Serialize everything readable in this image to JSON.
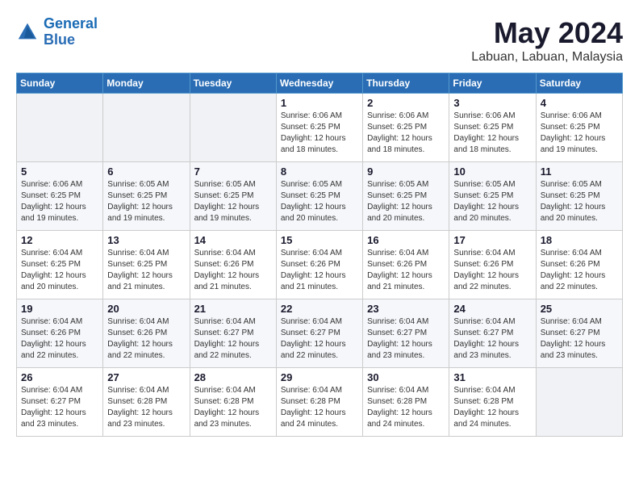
{
  "header": {
    "logo_line1": "General",
    "logo_line2": "Blue",
    "month": "May 2024",
    "location": "Labuan, Labuan, Malaysia"
  },
  "days_of_week": [
    "Sunday",
    "Monday",
    "Tuesday",
    "Wednesday",
    "Thursday",
    "Friday",
    "Saturday"
  ],
  "weeks": [
    [
      {
        "num": "",
        "info": ""
      },
      {
        "num": "",
        "info": ""
      },
      {
        "num": "",
        "info": ""
      },
      {
        "num": "1",
        "info": "Sunrise: 6:06 AM\nSunset: 6:25 PM\nDaylight: 12 hours\nand 18 minutes."
      },
      {
        "num": "2",
        "info": "Sunrise: 6:06 AM\nSunset: 6:25 PM\nDaylight: 12 hours\nand 18 minutes."
      },
      {
        "num": "3",
        "info": "Sunrise: 6:06 AM\nSunset: 6:25 PM\nDaylight: 12 hours\nand 18 minutes."
      },
      {
        "num": "4",
        "info": "Sunrise: 6:06 AM\nSunset: 6:25 PM\nDaylight: 12 hours\nand 19 minutes."
      }
    ],
    [
      {
        "num": "5",
        "info": "Sunrise: 6:06 AM\nSunset: 6:25 PM\nDaylight: 12 hours\nand 19 minutes."
      },
      {
        "num": "6",
        "info": "Sunrise: 6:05 AM\nSunset: 6:25 PM\nDaylight: 12 hours\nand 19 minutes."
      },
      {
        "num": "7",
        "info": "Sunrise: 6:05 AM\nSunset: 6:25 PM\nDaylight: 12 hours\nand 19 minutes."
      },
      {
        "num": "8",
        "info": "Sunrise: 6:05 AM\nSunset: 6:25 PM\nDaylight: 12 hours\nand 20 minutes."
      },
      {
        "num": "9",
        "info": "Sunrise: 6:05 AM\nSunset: 6:25 PM\nDaylight: 12 hours\nand 20 minutes."
      },
      {
        "num": "10",
        "info": "Sunrise: 6:05 AM\nSunset: 6:25 PM\nDaylight: 12 hours\nand 20 minutes."
      },
      {
        "num": "11",
        "info": "Sunrise: 6:05 AM\nSunset: 6:25 PM\nDaylight: 12 hours\nand 20 minutes."
      }
    ],
    [
      {
        "num": "12",
        "info": "Sunrise: 6:04 AM\nSunset: 6:25 PM\nDaylight: 12 hours\nand 20 minutes."
      },
      {
        "num": "13",
        "info": "Sunrise: 6:04 AM\nSunset: 6:25 PM\nDaylight: 12 hours\nand 21 minutes."
      },
      {
        "num": "14",
        "info": "Sunrise: 6:04 AM\nSunset: 6:26 PM\nDaylight: 12 hours\nand 21 minutes."
      },
      {
        "num": "15",
        "info": "Sunrise: 6:04 AM\nSunset: 6:26 PM\nDaylight: 12 hours\nand 21 minutes."
      },
      {
        "num": "16",
        "info": "Sunrise: 6:04 AM\nSunset: 6:26 PM\nDaylight: 12 hours\nand 21 minutes."
      },
      {
        "num": "17",
        "info": "Sunrise: 6:04 AM\nSunset: 6:26 PM\nDaylight: 12 hours\nand 22 minutes."
      },
      {
        "num": "18",
        "info": "Sunrise: 6:04 AM\nSunset: 6:26 PM\nDaylight: 12 hours\nand 22 minutes."
      }
    ],
    [
      {
        "num": "19",
        "info": "Sunrise: 6:04 AM\nSunset: 6:26 PM\nDaylight: 12 hours\nand 22 minutes."
      },
      {
        "num": "20",
        "info": "Sunrise: 6:04 AM\nSunset: 6:26 PM\nDaylight: 12 hours\nand 22 minutes."
      },
      {
        "num": "21",
        "info": "Sunrise: 6:04 AM\nSunset: 6:27 PM\nDaylight: 12 hours\nand 22 minutes."
      },
      {
        "num": "22",
        "info": "Sunrise: 6:04 AM\nSunset: 6:27 PM\nDaylight: 12 hours\nand 22 minutes."
      },
      {
        "num": "23",
        "info": "Sunrise: 6:04 AM\nSunset: 6:27 PM\nDaylight: 12 hours\nand 23 minutes."
      },
      {
        "num": "24",
        "info": "Sunrise: 6:04 AM\nSunset: 6:27 PM\nDaylight: 12 hours\nand 23 minutes."
      },
      {
        "num": "25",
        "info": "Sunrise: 6:04 AM\nSunset: 6:27 PM\nDaylight: 12 hours\nand 23 minutes."
      }
    ],
    [
      {
        "num": "26",
        "info": "Sunrise: 6:04 AM\nSunset: 6:27 PM\nDaylight: 12 hours\nand 23 minutes."
      },
      {
        "num": "27",
        "info": "Sunrise: 6:04 AM\nSunset: 6:28 PM\nDaylight: 12 hours\nand 23 minutes."
      },
      {
        "num": "28",
        "info": "Sunrise: 6:04 AM\nSunset: 6:28 PM\nDaylight: 12 hours\nand 23 minutes."
      },
      {
        "num": "29",
        "info": "Sunrise: 6:04 AM\nSunset: 6:28 PM\nDaylight: 12 hours\nand 24 minutes."
      },
      {
        "num": "30",
        "info": "Sunrise: 6:04 AM\nSunset: 6:28 PM\nDaylight: 12 hours\nand 24 minutes."
      },
      {
        "num": "31",
        "info": "Sunrise: 6:04 AM\nSunset: 6:28 PM\nDaylight: 12 hours\nand 24 minutes."
      },
      {
        "num": "",
        "info": ""
      }
    ]
  ]
}
